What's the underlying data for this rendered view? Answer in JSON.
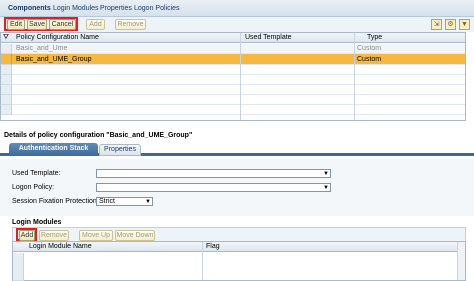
{
  "nav": {
    "tabs": [
      "Components",
      "Login Modules",
      "Properties",
      "Logon Policies"
    ]
  },
  "toolbar": {
    "edit": "Edit",
    "save": "Save",
    "cancel": "Cancel",
    "add": "Add",
    "remove": "Remove"
  },
  "policy_table": {
    "headers": [
      "Policy Configuration Name",
      "Used Template",
      "Type"
    ],
    "rows": [
      {
        "name": "Basic_and_Ume",
        "template": "",
        "type": "Custom"
      },
      {
        "name": "Basic_and_UME_Group",
        "template": "",
        "type": "Custom"
      }
    ]
  },
  "details": {
    "title": "Details of policy configuration \"Basic_and_UME_Group\"",
    "tabs": [
      "Authentication Stack",
      "Properties"
    ]
  },
  "form": {
    "used_template_label": "Used Template:",
    "logon_policy_label": "Logon Policy:",
    "session_fixation_label": "Session Fixation Protection:",
    "session_fixation_value": "Strict"
  },
  "login_modules": {
    "title": "Login Modules",
    "toolbar": {
      "add": "Add",
      "remove": "Remove",
      "move_up": "Move Up",
      "move_down": "Move Down"
    },
    "headers": [
      "Login Module Name",
      "Flag"
    ]
  },
  "colors": {
    "selected_row": "#f5b942",
    "highlight": "#e02020",
    "tab_active": "#3d6a9a"
  }
}
